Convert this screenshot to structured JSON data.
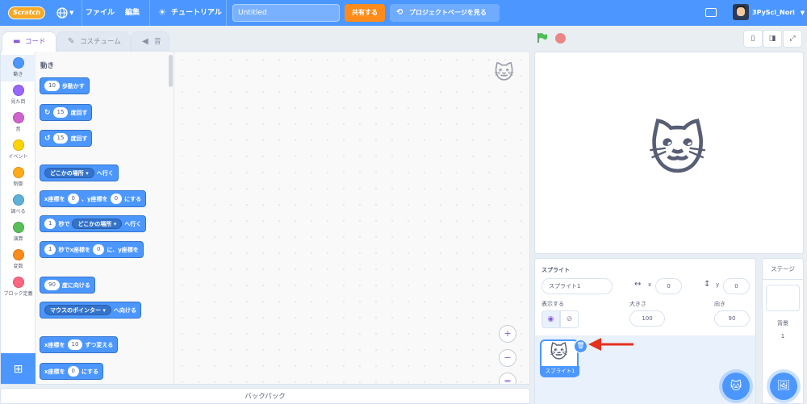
{
  "menubar": {
    "logo_text": "Scratch",
    "file": "ファイル",
    "edit": "編集",
    "tutorial": "チュートリアル",
    "project_title": "Untitled",
    "share": "共有する",
    "project_page": "プロジェクトページを見る",
    "username": "3PySci_Nori"
  },
  "tabs": {
    "code": "コード",
    "costume": "コスチューム",
    "sound": "音"
  },
  "categories": [
    {
      "label": "動き",
      "color": "#4c97ff"
    },
    {
      "label": "見た目",
      "color": "#9966ff"
    },
    {
      "label": "音",
      "color": "#cf63cf"
    },
    {
      "label": "イベント",
      "color": "#ffd500"
    },
    {
      "label": "制御",
      "color": "#ffab19"
    },
    {
      "label": "調べる",
      "color": "#5cb1d6"
    },
    {
      "label": "演算",
      "color": "#59c059"
    },
    {
      "label": "変数",
      "color": "#ff8c1a"
    },
    {
      "label": "ブロック定義",
      "color": "#ff6680"
    }
  ],
  "palette": {
    "title": "動き",
    "blocks": {
      "move_val": "10",
      "move_text": "歩動かす",
      "turn_r_val": "15",
      "turn_r_text": "度回す",
      "turn_l_val": "15",
      "turn_l_text": "度回す",
      "goto_drop": "どこかの場所",
      "goto_text": "へ行く",
      "gotoxy_a": "x座標を",
      "gotoxy_x": "0",
      "gotoxy_b": "、y座標を",
      "gotoxy_y": "0",
      "gotoxy_c": "にする",
      "glide_val": "1",
      "glide_a": "秒で",
      "glide_drop": "どこかの場所",
      "glide_b": "へ行く",
      "glidexy_val": "1",
      "glidexy_a": "秒でx座標を",
      "glidexy_x": "0",
      "glidexy_b": "に、y座標を",
      "point_val": "90",
      "point_text": "度に向ける",
      "towards_drop": "マウスのポインター",
      "towards_text": "へ向ける",
      "changex_a": "x座標を",
      "changex_val": "10",
      "changex_b": "ずつ変える",
      "setx_a": "x座標を",
      "setx_val": "0",
      "setx_b": "にする"
    }
  },
  "zoom": {
    "in": "+",
    "out": "−",
    "reset": "="
  },
  "backpack": "バックパック",
  "sprite_info": {
    "sprite_label": "スプライト",
    "sprite_name": "スプライト1",
    "x_label": "x",
    "x_value": "0",
    "y_label": "y",
    "y_value": "0",
    "show_label": "表示する",
    "size_label": "大きさ",
    "size_value": "100",
    "direction_label": "向き",
    "direction_value": "90"
  },
  "sprite_list": [
    {
      "name": "スプライト1",
      "selected": true
    }
  ],
  "stage_pane": {
    "title": "ステージ",
    "backdrop_label": "背景",
    "backdrop_count": "1"
  },
  "colors": {
    "menubar": "#4c97ff",
    "share": "#ff8c1a",
    "motion": "#4c97ff",
    "arrow": "#e6301e"
  }
}
